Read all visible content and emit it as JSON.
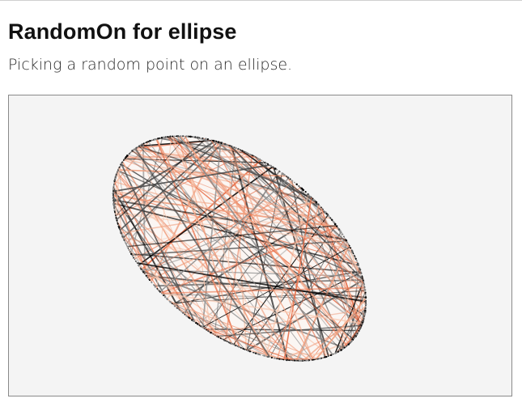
{
  "header": {
    "title": "RandomOn for ellipse",
    "subtitle": "Picking a random point on an ellipse."
  },
  "demo": {
    "background_color": "#f4f4f4",
    "border_color": "#8a8a8a",
    "line_colors": [
      "#000000",
      "#4a4a4a",
      "#8c8c8c",
      "#f0a080",
      "#e8704a",
      "#f8c8b0"
    ]
  }
}
